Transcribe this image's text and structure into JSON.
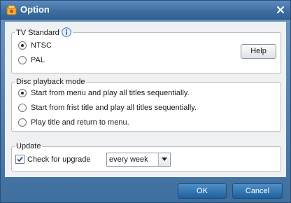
{
  "window": {
    "title": "Option"
  },
  "tv_standard": {
    "legend": "TV Standard",
    "options": [
      "NTSC",
      "PAL"
    ],
    "selected": 0,
    "help_label": "Help"
  },
  "disc_playback": {
    "legend": "Disc playback mode",
    "options": [
      "Start from menu and play all titles sequentially.",
      "Start from frist title and play all titles sequentially.",
      "Play title and return to menu."
    ],
    "selected": 0
  },
  "update": {
    "legend": "Update",
    "check_label": "Check for upgrade",
    "checked": true,
    "frequency": "every week"
  },
  "footer": {
    "ok_label": "OK",
    "cancel_label": "Cancel"
  },
  "colors": {
    "title_bar": "#3e6fa3",
    "primary_button": "#2f6fa8",
    "panel_background": "#eef0f2"
  }
}
